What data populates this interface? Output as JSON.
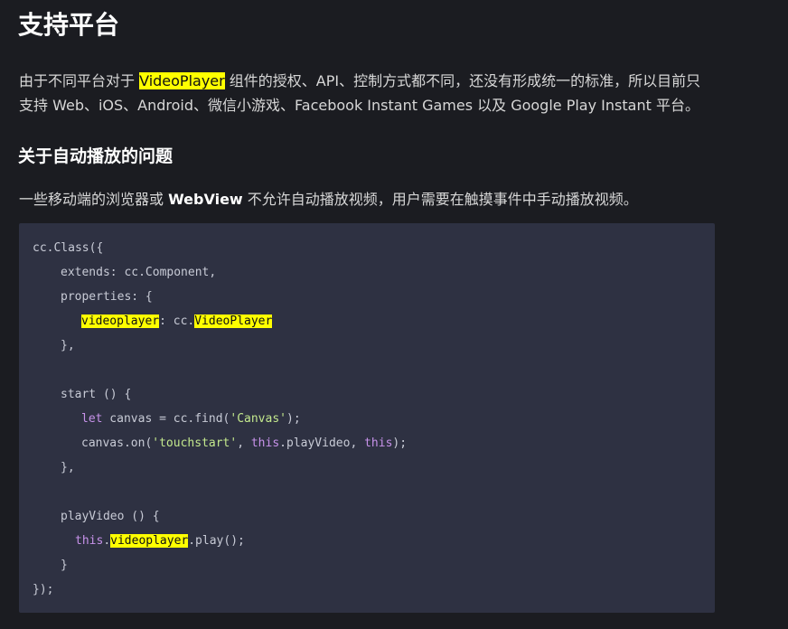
{
  "section": {
    "title": "支持平台",
    "para_part1": "由于不同平台对于 ",
    "para_highlight": "VideoPlayer",
    "para_part2": " 组件的授权、API、控制方式都不同，还没有形成统一的标准，所以目前只",
    "para_line2": "支持 Web、iOS、Android、微信小游戏、Facebook Instant Games 以及 Google Play Instant 平台。"
  },
  "subsection": {
    "title": "关于自动播放的问题",
    "para_part1": "一些移动端的浏览器或 ",
    "para_bold": "WebView",
    "para_part2": " 不允许自动播放视频，用户需要在触摸事件中手动播放视频。"
  },
  "code": {
    "l1": "cc.Class({",
    "l2": "extends: cc.Component,",
    "l3": "properties: {",
    "l4_hl1": "videoplayer",
    "l4_mid": ": cc.",
    "l4_hl2": "VideoPlayer",
    "l5": "},",
    "l7": "start () {",
    "l8_kw": "let",
    "l8_mid": " canvas = cc.find(",
    "l8_str": "'Canvas'",
    "l8_end": ");",
    "l9_a": "canvas.on(",
    "l9_str": "'touchstart'",
    "l9_b": ", ",
    "l9_kw1": "this",
    "l9_c": ".playVideo, ",
    "l9_kw2": "this",
    "l9_d": ");",
    "l10": "},",
    "l12": "playVideo () {",
    "l13_kw": "this",
    "l13_a": ".",
    "l13_hl": "videoplayer",
    "l13_b": ".play();",
    "l14": "}",
    "l15": "});"
  }
}
